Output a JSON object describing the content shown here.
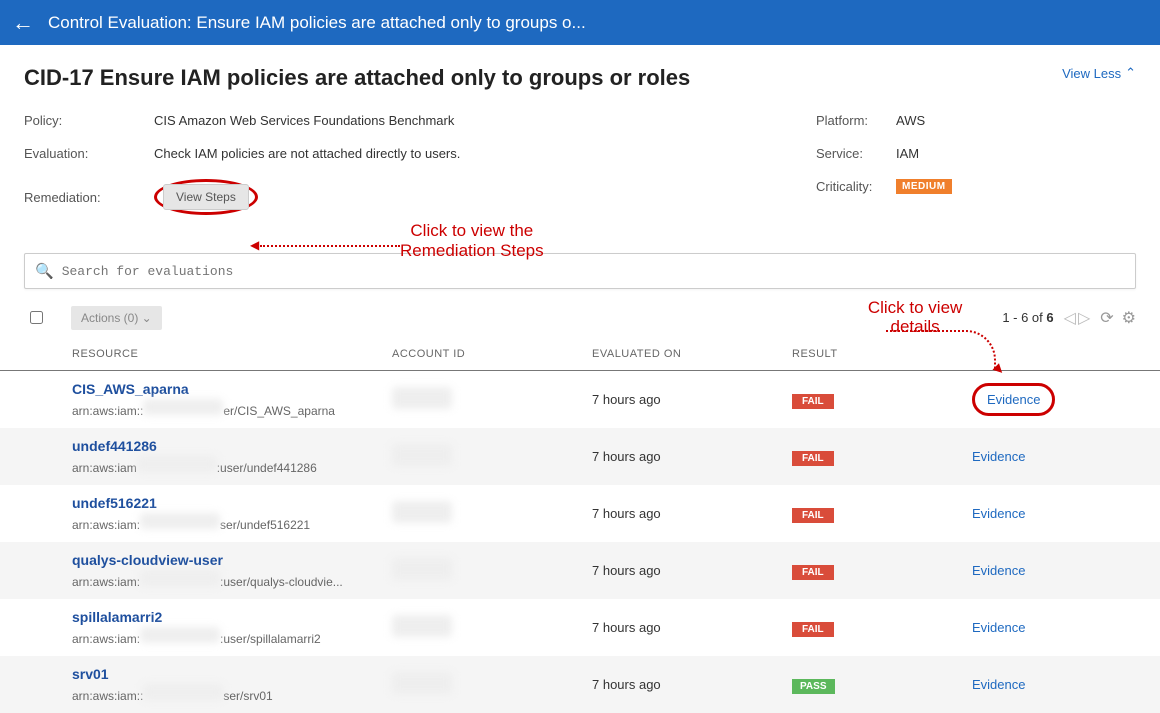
{
  "appbar": {
    "title": "Control Evaluation: Ensure IAM policies are attached only to groups o..."
  },
  "panel": {
    "title": "CID-17 Ensure IAM policies are attached only to groups or roles",
    "view_less": "View Less",
    "policy_label": "Policy:",
    "policy_value": "CIS Amazon Web Services Foundations Benchmark",
    "evaluation_label": "Evaluation:",
    "evaluation_value": "Check IAM policies are not attached directly to users.",
    "remediation_label": "Remediation:",
    "view_steps": "View Steps",
    "platform_label": "Platform:",
    "platform_value": "AWS",
    "service_label": "Service:",
    "service_value": "IAM",
    "criticality_label": "Criticality:",
    "criticality_value": "MEDIUM"
  },
  "annotations": {
    "remediation": "Click to view the\nRemediation Steps",
    "evidence": "Click to view\ndetails"
  },
  "search": {
    "placeholder": "Search for evaluations"
  },
  "toolbar": {
    "actions": "Actions (0)  ⌄"
  },
  "pager": {
    "text_prefix": "1 - 6 of ",
    "total": "6"
  },
  "columns": {
    "resource": "RESOURCE",
    "account": "ACCOUNT ID",
    "evaluated": "EVALUATED ON",
    "result": "RESULT"
  },
  "rows": [
    {
      "name": "CIS_AWS_aparna",
      "sub_a": "arn:aws:iam::",
      "sub_b": "er/CIS_AWS_aparna",
      "eval": "7 hours ago",
      "result": "FAIL",
      "evidence": "Evidence",
      "circled": true
    },
    {
      "name": "undef441286",
      "sub_a": "arn:aws:iam",
      "sub_b": ":user/undef441286",
      "eval": "7 hours ago",
      "result": "FAIL",
      "evidence": "Evidence"
    },
    {
      "name": "undef516221",
      "sub_a": "arn:aws:iam:",
      "sub_b": "ser/undef516221",
      "eval": "7 hours ago",
      "result": "FAIL",
      "evidence": "Evidence"
    },
    {
      "name": "qualys-cloudview-user",
      "sub_a": "arn:aws:iam:",
      "sub_b": ":user/qualys-cloudvie...",
      "eval": "7 hours ago",
      "result": "FAIL",
      "evidence": "Evidence"
    },
    {
      "name": "spillalamarri2",
      "sub_a": "arn:aws:iam:",
      "sub_b": ":user/spillalamarri2",
      "eval": "7 hours ago",
      "result": "FAIL",
      "evidence": "Evidence"
    },
    {
      "name": "srv01",
      "sub_a": "arn:aws:iam::",
      "sub_b": "ser/srv01",
      "eval": "7 hours ago",
      "result": "PASS",
      "evidence": "Evidence"
    }
  ]
}
